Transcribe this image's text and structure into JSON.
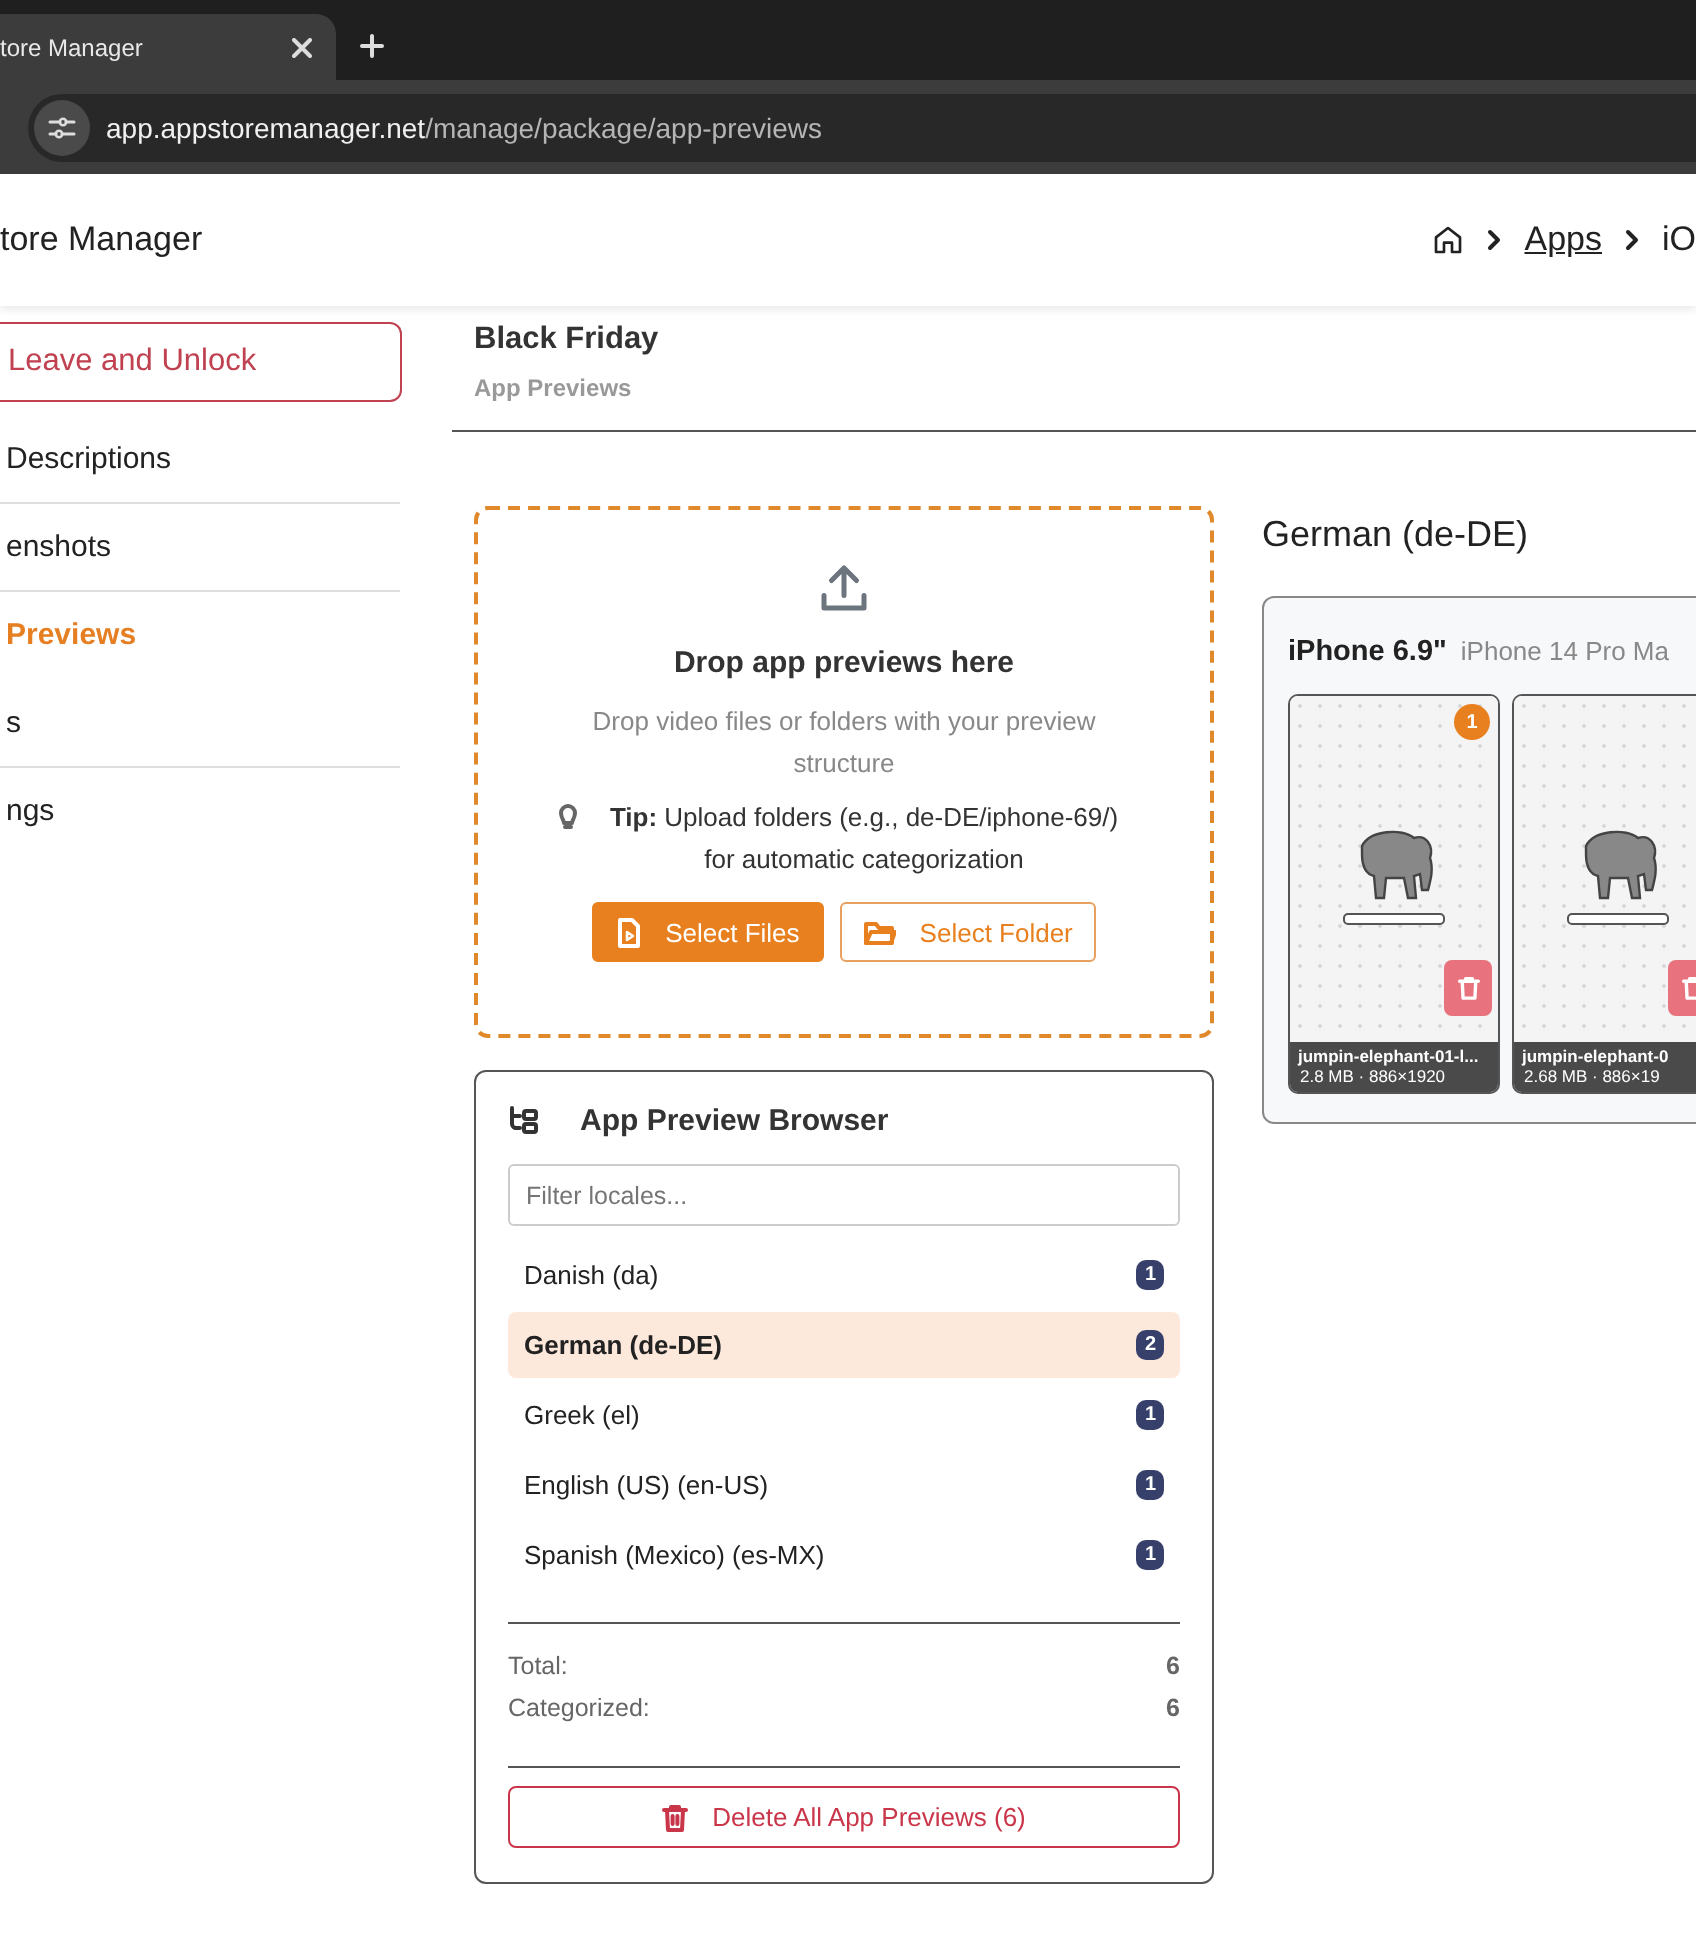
{
  "browser": {
    "tab_title": "tore Manager",
    "url_host": "app.appstoremanager.net",
    "url_path": "/manage/package/app-previews"
  },
  "header": {
    "title": "tore Manager",
    "breadcrumbs": [
      {
        "label": "Apps",
        "link": true
      },
      {
        "label": "iO",
        "link": false
      }
    ]
  },
  "sidebar": {
    "action": "Leave and Unlock",
    "items": [
      {
        "label": "Descriptions",
        "selected": false
      },
      {
        "label": "enshots",
        "selected": false
      },
      {
        "label": "Previews",
        "selected": true
      },
      {
        "label": "s",
        "selected": false
      },
      {
        "label": "ngs",
        "selected": false
      }
    ]
  },
  "page": {
    "title": "Black Friday",
    "subtitle": "App Previews"
  },
  "dropzone": {
    "title": "Drop app previews here",
    "description": "Drop video files or folders with your preview structure",
    "tip": "**Tip:** Upload folders (e.g., de-DE/iphone-69/) for automatic categorization",
    "buttons": [
      {
        "label": "Select Files",
        "kind": "primary"
      },
      {
        "label": "Select Folder",
        "kind": "outline"
      }
    ]
  },
  "preview_browser": {
    "title": "App Preview Browser",
    "filter": {
      "placeholder": "Filter locales..."
    },
    "locales": [
      {
        "name": "Danish (da)",
        "count": "1",
        "selected": false
      },
      {
        "name": "German (de-DE)",
        "count": "2",
        "selected": true
      },
      {
        "name": "Greek (el)",
        "count": "1",
        "selected": false
      },
      {
        "name": "English (US) (en-US)",
        "count": "1",
        "selected": false
      },
      {
        "name": "Spanish (Mexico) (es-MX)",
        "count": "1",
        "selected": false
      }
    ],
    "stats": [
      {
        "label": "Total:",
        "value": "6"
      },
      {
        "label": "Categorized:",
        "value": "6"
      }
    ],
    "delete_button": "Delete All App Previews (6)"
  },
  "locale_view": {
    "title": "German (de-DE)",
    "devices": [
      {
        "name": "iPhone 6.9\"",
        "model": "iPhone 14 Pro Ma",
        "previews": [
          {
            "file": "jumpin-elephant-01-l...",
            "info": "2.8 MB · 886×1920",
            "order": "1"
          },
          {
            "file": "jumpin-elephant-0",
            "info": "2.68 MB · 886×19"
          }
        ]
      }
    ]
  }
}
